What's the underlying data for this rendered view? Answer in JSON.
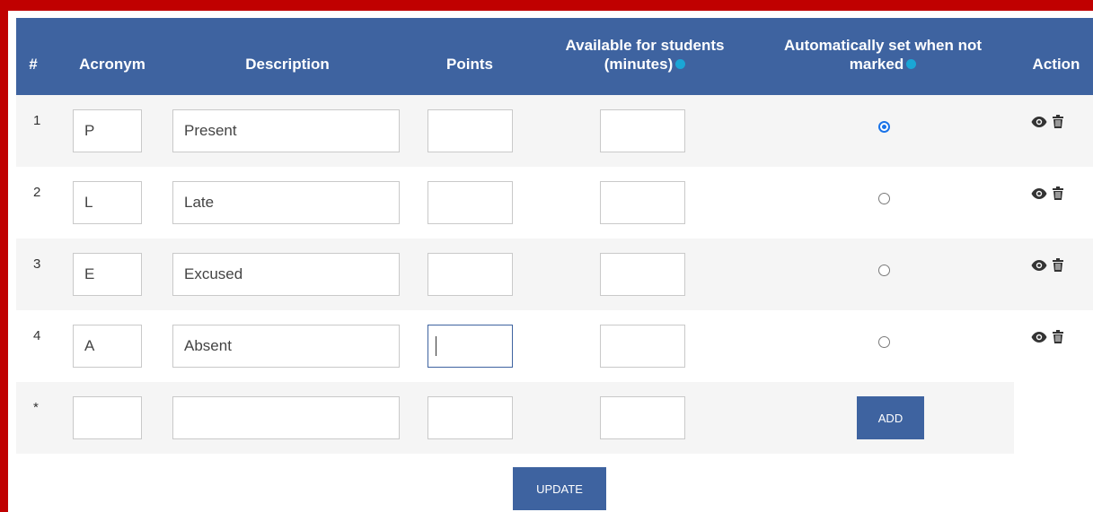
{
  "header": {
    "num": "#",
    "acronym": "Acronym",
    "description": "Description",
    "points": "Points",
    "available_line1": "Available for students",
    "available_line2": "(minutes)",
    "auto_line1": "Automatically set when not",
    "auto_line2": "marked",
    "action": "Action"
  },
  "rows": [
    {
      "num": "1",
      "acronym": "P",
      "description": "Present",
      "points": "",
      "available": "",
      "auto_set": true
    },
    {
      "num": "2",
      "acronym": "L",
      "description": "Late",
      "points": "",
      "available": "",
      "auto_set": false
    },
    {
      "num": "3",
      "acronym": "E",
      "description": "Excused",
      "points": "",
      "available": "",
      "auto_set": false
    },
    {
      "num": "4",
      "acronym": "A",
      "description": "Absent",
      "points": "",
      "available": "",
      "auto_set": false
    }
  ],
  "new_row": {
    "num": "*",
    "acronym": "",
    "description": "",
    "points": "",
    "available": ""
  },
  "buttons": {
    "add": "ADD",
    "update": "UPDATE"
  },
  "colors": {
    "header_bg": "#3e63a0",
    "frame": "#c00000",
    "help": "#1aa6d6",
    "radio_on": "#1a73e8"
  },
  "icons": {
    "help": "info-icon",
    "view": "eye-icon",
    "delete": "trash-icon"
  }
}
